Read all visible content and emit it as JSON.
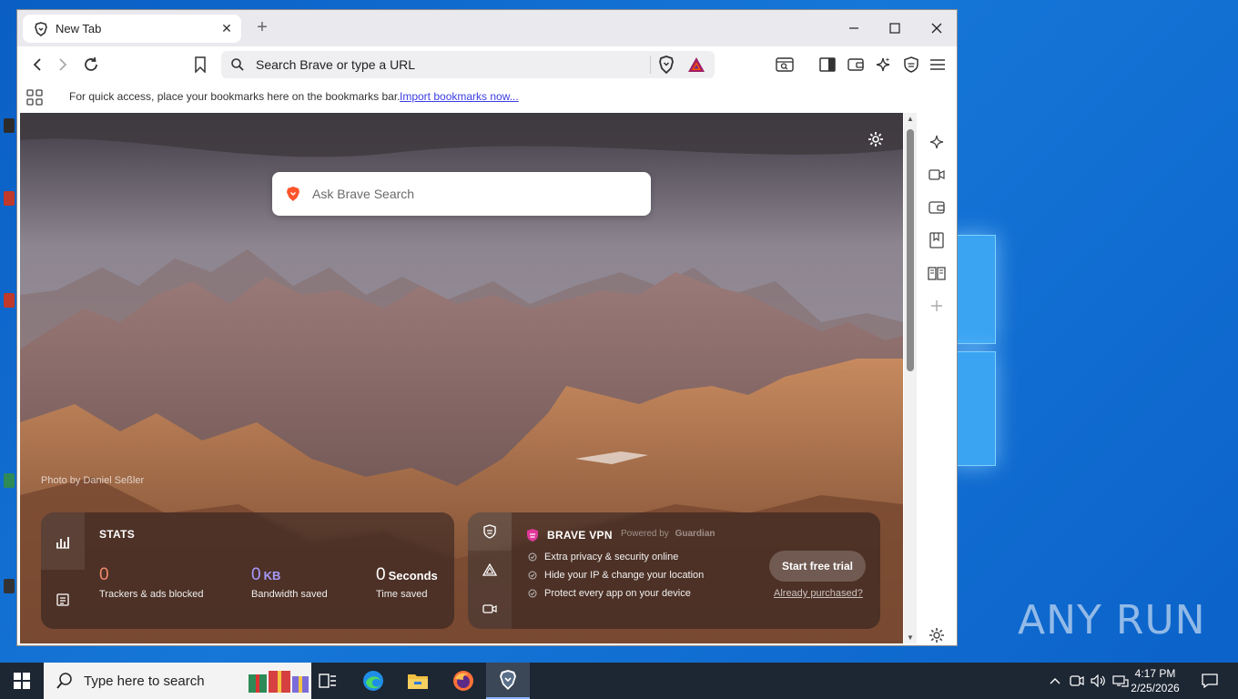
{
  "browser": {
    "tab_title": "New Tab",
    "omnibox_text": "Search Brave or type a URL",
    "bookmarks_message": "For quick access, place your bookmarks here on the bookmarks bar.",
    "import_link": "Import bookmarks now..."
  },
  "newtab": {
    "search_placeholder": "Ask Brave Search",
    "photo_credit": "Photo by Daniel Seßler",
    "stats": {
      "heading": "STATS",
      "trackers_value": "0",
      "trackers_label": "Trackers & ads blocked",
      "bandwidth_value": "0",
      "bandwidth_unit": "KB",
      "bandwidth_label": "Bandwidth saved",
      "time_value": "0",
      "time_unit": "Seconds",
      "time_label": "Time saved"
    },
    "vpn": {
      "title": "BRAVE VPN",
      "powered_by": "Powered by",
      "powered_brand": "Guardian",
      "features": [
        "Extra privacy & security online",
        "Hide your IP & change your location",
        "Protect every app on your device"
      ],
      "cta": "Start free trial",
      "already_purchased": "Already purchased?"
    }
  },
  "taskbar": {
    "search_placeholder": "Type here to search",
    "time": "4:17 PM",
    "date": "2/25/2026"
  },
  "desktop": {
    "watermark": "ANY RUN"
  },
  "colors": {
    "trackers": "#f08a6b",
    "bandwidth": "#a69bff",
    "vpn_shield": "#e0389a",
    "bat_triangle": "#9e1f63"
  }
}
